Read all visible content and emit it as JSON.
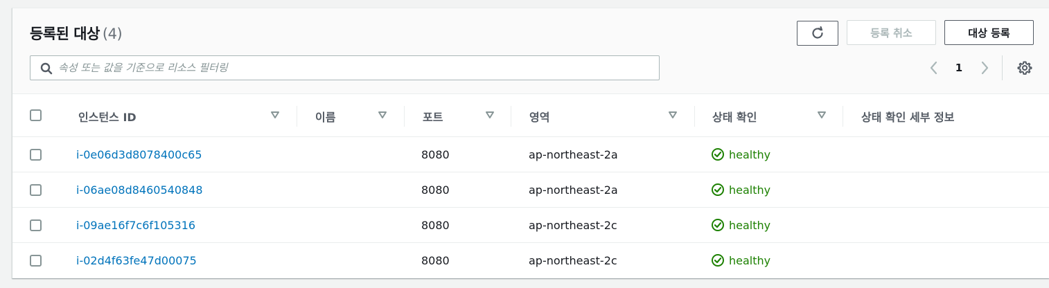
{
  "header": {
    "title": "등록된 대상",
    "count": "(4)"
  },
  "actions": {
    "refresh_icon": "refresh-icon",
    "deregister_label": "등록 취소",
    "register_label": "대상 등록"
  },
  "search": {
    "placeholder": "속성 또는 값을 기준으로 리소스 필터링",
    "value": ""
  },
  "pagination": {
    "current_page": "1"
  },
  "table": {
    "columns": [
      {
        "label": "인스턴스 ID",
        "sortable": true
      },
      {
        "label": "이름",
        "sortable": true
      },
      {
        "label": "포트",
        "sortable": true
      },
      {
        "label": "영역",
        "sortable": true
      },
      {
        "label": "상태 확인",
        "sortable": true
      },
      {
        "label": "상태 확인 세부 정보",
        "sortable": false
      }
    ],
    "rows": [
      {
        "instance_id": "i-0e06d3d8078400c65",
        "name": "",
        "port": "8080",
        "zone": "ap-northeast-2a",
        "health": "healthy",
        "details": ""
      },
      {
        "instance_id": "i-06ae08d8460540848",
        "name": "",
        "port": "8080",
        "zone": "ap-northeast-2a",
        "health": "healthy",
        "details": ""
      },
      {
        "instance_id": "i-09ae16f7c6f105316",
        "name": "",
        "port": "8080",
        "zone": "ap-northeast-2c",
        "health": "healthy",
        "details": ""
      },
      {
        "instance_id": "i-02d4f63fe47d00075",
        "name": "",
        "port": "8080",
        "zone": "ap-northeast-2c",
        "health": "healthy",
        "details": ""
      }
    ]
  },
  "colors": {
    "link": "#0073bb",
    "healthy": "#1d8102",
    "disabled_text": "#aab7b8",
    "border": "#545b64"
  }
}
